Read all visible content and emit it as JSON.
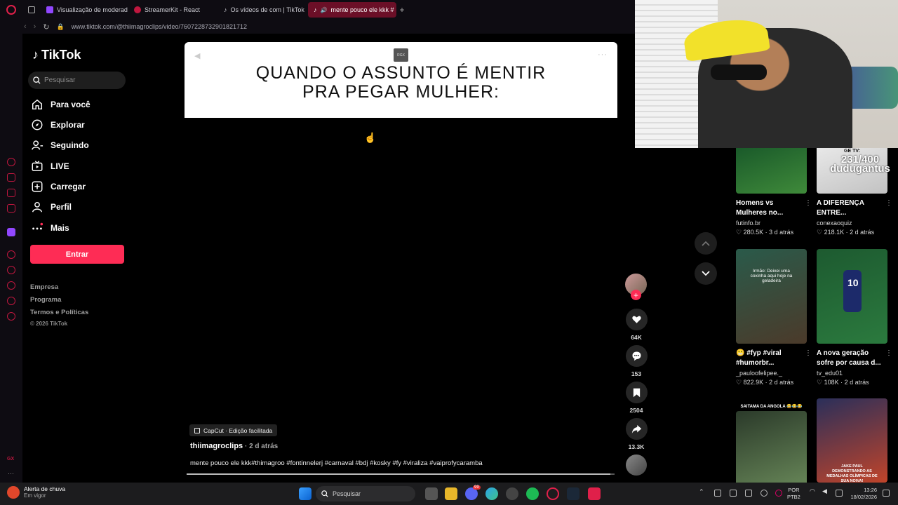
{
  "browser": {
    "tabs": [
      {
        "label": "Visualização de moderad",
        "fav_color": "#9147ff"
      },
      {
        "label": "StreamerKit - React",
        "fav_color": "#c0173f"
      },
      {
        "label": "Os vídeos de com | TikTok",
        "fav_color": "#222"
      },
      {
        "label": "mente pouco ele kkk #",
        "fav_color": "#222"
      }
    ],
    "url": "www.tiktok.com/@thiimagroclips/video/7607228732901821712"
  },
  "sidebar": {
    "brand": "TikTok",
    "search_placeholder": "Pesquisar",
    "nav": [
      {
        "label": "Para você",
        "icon": "home-icon"
      },
      {
        "label": "Explorar",
        "icon": "compass-icon"
      },
      {
        "label": "Seguindo",
        "icon": "following-icon"
      },
      {
        "label": "LIVE",
        "icon": "live-icon"
      },
      {
        "label": "Carregar",
        "icon": "upload-icon"
      },
      {
        "label": "Perfil",
        "icon": "profile-icon"
      },
      {
        "label": "Mais",
        "icon": "more-icon"
      }
    ],
    "login_label": "Entrar",
    "footer_links": [
      "Empresa",
      "Programa",
      "Termos e Políticas"
    ],
    "copyright": "© 2026 TikTok"
  },
  "video": {
    "banner_line1": "QUANDO O ASSUNTO É MENTIR",
    "banner_line2": "PRA PEGAR MULHER:",
    "badge": "RGX",
    "capcut": "CapCut · Edição facilitada",
    "author": "thiimagroclips",
    "posted": " · 2 d atrás",
    "caption": "mente pouco ele kkk#thimagroo #fontinnelerj #carnaval #bdj #kosky #fy #viraliza #vaiprofycaramba",
    "progress_fraction": 0.99
  },
  "actions": {
    "likes": "64K",
    "comments": "153",
    "saves": "2504",
    "shares": "13.3K"
  },
  "recommendations": [
    {
      "title1": "Homens vs",
      "title2": "Mulheres no...",
      "author": "futinfo.br",
      "views": "280.5K",
      "age": "3 d atrás",
      "colors": [
        "#1a5a2a",
        "#3f8a3a"
      ]
    },
    {
      "title1": "A DIFERENÇA",
      "title2": "ENTRE...",
      "author": "conexaoquiz",
      "views": "218.1K",
      "age": "2 d atrás",
      "colors": [
        "#e8e8e8",
        "#c2c2c2"
      ],
      "overlay_top": "GE TV:",
      "overlay_big1": "231/400",
      "overlay_big2": "dudugantus"
    },
    {
      "title1": "😬 #fyp #viral",
      "title2": "#humorbr...",
      "author": "_pauloofelipee._",
      "views": "822.9K",
      "age": "2 d atrás",
      "colors": [
        "#2a5a4a",
        "#4b3a2a"
      ],
      "overlay_text": "Irmão: Deixei uma coxinha aqui hoje na geladeira"
    },
    {
      "title1": "A nova geração",
      "title2": "sofre por causa d...",
      "author": "tv_edu01",
      "views": "108K",
      "age": "2 d atrás",
      "colors": [
        "#1d5a30",
        "#2b7a3e"
      ]
    },
    {
      "title1": "",
      "title2": "",
      "author": "",
      "views": "",
      "age": "",
      "colors": [
        "#2b3a2a",
        "#6a8a5a"
      ],
      "overlay_text": "SAITAMA DA ANGOLA 😂😂😂"
    },
    {
      "title1": "",
      "title2": "",
      "author": "",
      "views": "",
      "age": "",
      "colors": [
        "#2a2f5a",
        "#c0442a"
      ],
      "overlay_text": "JAKE PAUL DEMONSTRANDO AS MEDALHAS OLÍMPICAS DE SUA NOIVA!"
    }
  ],
  "taskbar": {
    "weather_title": "Alerta de chuva",
    "weather_sub": "Em vigor",
    "search_placeholder": "Pesquisar",
    "lang1": "POR",
    "lang2": "PTB2",
    "time": "13:26",
    "date": "18/02/2026",
    "discord_badge": "99"
  },
  "opera_side": {
    "gx_label": "GX"
  }
}
